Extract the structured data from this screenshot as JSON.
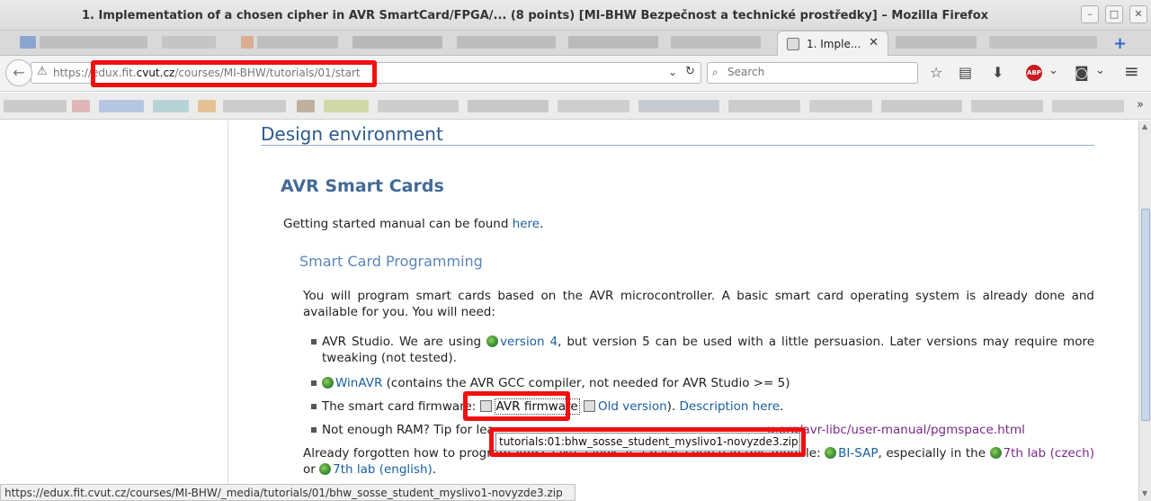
{
  "window": {
    "title": "1. Implementation of a chosen cipher in AVR SmartCard/FPGA/... (8 points) [MI-BHW Bezpečnost a technické prostředky] – Mozilla Firefox",
    "min_glyph": "–",
    "max_glyph": "□",
    "close_glyph": "✕"
  },
  "tabs": {
    "active_label": "1. Imple...",
    "close_glyph": "✕",
    "new_tab_glyph": "+"
  },
  "nav": {
    "back_glyph": "←",
    "warn_glyph": "⚠",
    "url_scheme": "https://",
    "url_pre": "edux.fit.",
    "url_domain": "cvut.cz",
    "url_path": "/courses/MI-BHW/tutorials/01/start",
    "dropdown_glyph": "⌄",
    "reload_glyph": "↻",
    "search_placeholder": "Search",
    "search_glyph": "⌕"
  },
  "toolbar_icons": {
    "star": "☆",
    "reader": "▤",
    "download": "⬇",
    "abp": "ABP",
    "chev1": "⌄",
    "screenshot": "◙",
    "chev2": "⌄",
    "menu": "≡",
    "more_bookmarks": "»"
  },
  "page": {
    "design_env": "Design environment",
    "avr_cards": "AVR Smart Cards",
    "getting_started_pre": "Getting started manual can be found ",
    "getting_started_link": "here",
    "getting_started_post": ".",
    "programming": "Smart Card Programming",
    "intro": "You will program smart cards based on the AVR microcontroller. A basic smart card operating system is already done and available for you. You will need:",
    "item1_pre": "AVR Studio. We are using ",
    "item1_link": "version 4",
    "item1_post": ", but version 5 can be used with a little persuasion. Later versions may require more tweaking (not tested).",
    "item2_link": "WinAVR",
    "item2_post": " (contains the AVR GCC compiler, not needed for AVR Studio >= 5)",
    "item3_pre": "The smart card firmware: ",
    "item3_link1": "AVR firmware",
    "item3_link2": "Old version",
    "item3_mid": "). ",
    "item3_link3": "Description here",
    "item3_post": ".",
    "item4_pre": "Not enough RAM? Tip for lea",
    "item4_link": "u.org/avr-libc/user-manual/pgmspace.html",
    "forgotten_pre": "Already forgotten how to program AVR? Take a look at a basic course in this module: ",
    "forgotten_link1": "BI-SAP",
    "forgotten_mid": ", especially in the ",
    "forgotten_link2": "7th lab (czech)",
    "forgotten_or": " or",
    "forgotten_link3": "7th lab (english)",
    "forgotten_post": "."
  },
  "tooltip": "tutorials:01:bhw_sosse_student_myslivo1-novyzde3.zip",
  "status_url": "https://edux.fit.cvut.cz/courses/MI-BHW/_media/tutorials/01/bhw_sosse_student_myslivo1-novyzde3.zip",
  "colors": {
    "highlight": "#f01010",
    "link": "#1a5fa0",
    "visited": "#7a2a88",
    "heading": "#2c5a8a"
  }
}
